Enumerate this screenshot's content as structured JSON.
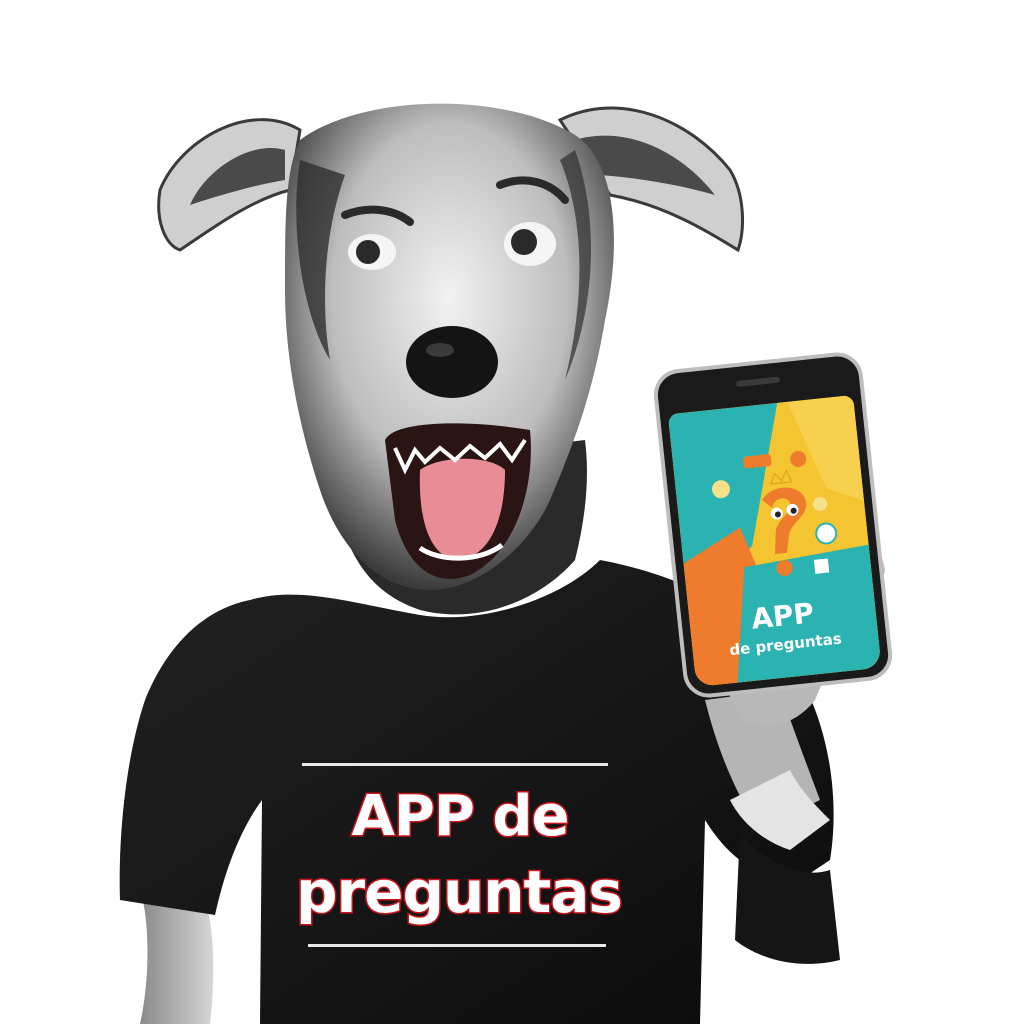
{
  "shirt": {
    "line1": "APP de",
    "line2": "preguntas"
  },
  "phone": {
    "title": "APP",
    "subtitle": "de preguntas"
  },
  "colors": {
    "shirt": "#161616",
    "fur_dark": "#3d3d3d",
    "fur_light": "#e6e6e6",
    "text_outline": "#c8161e",
    "screen_teal": "#2bb3b1",
    "screen_yellow": "#f4c531",
    "screen_orange": "#ef7b2c"
  }
}
